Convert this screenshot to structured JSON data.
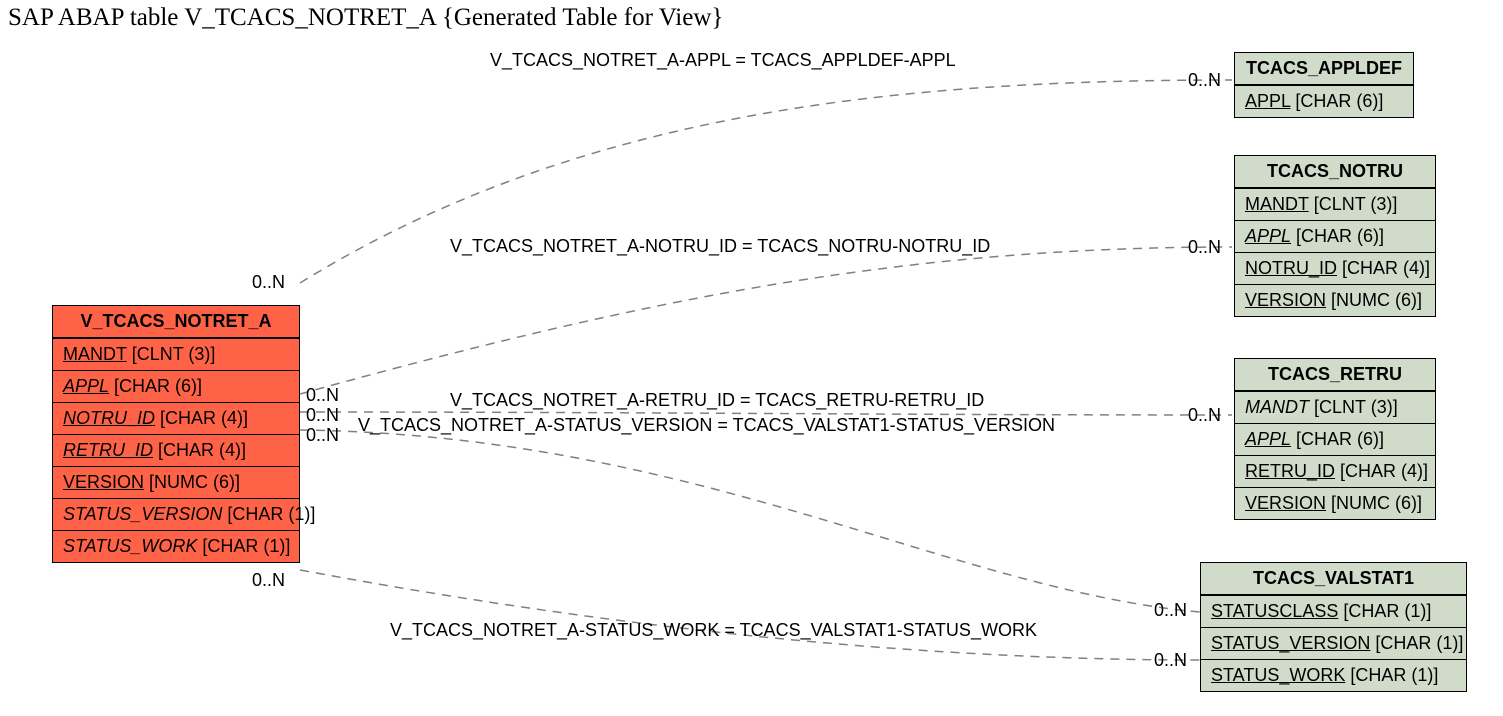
{
  "title": "SAP ABAP table V_TCACS_NOTRET_A {Generated Table for View}",
  "leftTable": {
    "name": "V_TCACS_NOTRET_A",
    "fields": {
      "f0": {
        "name": "MANDT",
        "type": "[CLNT (3)]",
        "cls": "pk"
      },
      "f1": {
        "name": "APPL",
        "type": "[CHAR (6)]",
        "cls": "fk"
      },
      "f2": {
        "name": "NOTRU_ID",
        "type": "[CHAR (4)]",
        "cls": "fk"
      },
      "f3": {
        "name": "RETRU_ID",
        "type": "[CHAR (4)]",
        "cls": "fk"
      },
      "f4": {
        "name": "VERSION",
        "type": "[NUMC (6)]",
        "cls": "pk"
      },
      "f5": {
        "name": "STATUS_VERSION",
        "type": " [CHAR (1)]",
        "cls": "ital"
      },
      "f6": {
        "name": "STATUS_WORK",
        "type": " [CHAR (1)]",
        "cls": "ital"
      }
    }
  },
  "rightTables": {
    "t0": {
      "name": "TCACS_APPLDEF",
      "fields": {
        "f0": {
          "name": "APPL",
          "type": "[CHAR (6)]",
          "cls": "pk"
        }
      }
    },
    "t1": {
      "name": "TCACS_NOTRU",
      "fields": {
        "f0": {
          "name": "MANDT",
          "type": "[CLNT (3)]",
          "cls": "pk"
        },
        "f1": {
          "name": "APPL",
          "type": "[CHAR (6)]",
          "cls": "fk"
        },
        "f2": {
          "name": "NOTRU_ID",
          "type": "[CHAR (4)]",
          "cls": "pk"
        },
        "f3": {
          "name": "VERSION",
          "type": "[NUMC (6)]",
          "cls": "pk"
        }
      }
    },
    "t2": {
      "name": "TCACS_RETRU",
      "fields": {
        "f0": {
          "name": "MANDT",
          "type": "[CLNT (3)]",
          "cls": "ital"
        },
        "f1": {
          "name": "APPL",
          "type": "[CHAR (6)]",
          "cls": "fk"
        },
        "f2": {
          "name": "RETRU_ID",
          "type": "[CHAR (4)]",
          "cls": "pk"
        },
        "f3": {
          "name": "VERSION",
          "type": "[NUMC (6)]",
          "cls": "pk"
        }
      }
    },
    "t3": {
      "name": "TCACS_VALSTAT1",
      "fields": {
        "f0": {
          "name": "STATUSCLASS",
          "type": "[CHAR (1)]",
          "cls": "pk"
        },
        "f1": {
          "name": "STATUS_VERSION",
          "type": " [CHAR (1)]",
          "cls": "pk"
        },
        "f2": {
          "name": "STATUS_WORK",
          "type": " [CHAR (1)]",
          "cls": "pk"
        }
      }
    }
  },
  "relations": {
    "r0": "V_TCACS_NOTRET_A-APPL = TCACS_APPLDEF-APPL",
    "r1": "V_TCACS_NOTRET_A-NOTRU_ID = TCACS_NOTRU-NOTRU_ID",
    "r2": "V_TCACS_NOTRET_A-RETRU_ID = TCACS_RETRU-RETRU_ID",
    "r3": "V_TCACS_NOTRET_A-STATUS_VERSION = TCACS_VALSTAT1-STATUS_VERSION",
    "r4": "V_TCACS_NOTRET_A-STATUS_WORK = TCACS_VALSTAT1-STATUS_WORK"
  },
  "card": {
    "l0": "0..N",
    "l1": "0..N",
    "l2": "0..N",
    "l3": "0..N",
    "l4": "0..N",
    "r0": "0..N",
    "r1": "0..N",
    "r2": "0..N",
    "r3": "0..N",
    "r4": "0..N"
  }
}
